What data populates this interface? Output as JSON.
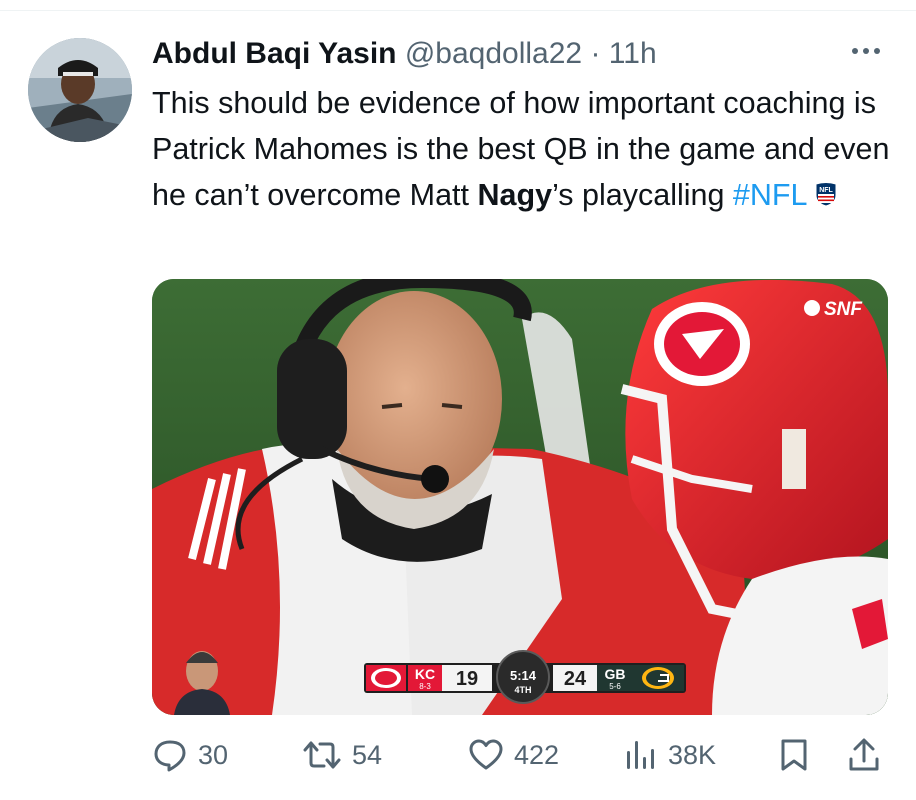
{
  "tweet": {
    "author_name": "Abdul Baqi Yasin",
    "handle": "@baqdolla22",
    "separator": "·",
    "time": "11h",
    "text_parts": {
      "p1": "This should be evidence of how important coaching is Patrick Mahomes is the best QB in the game and even he can’t overcome Matt ",
      "bold": "Nagy",
      "p2": "’s playcalling ",
      "hashtag": "#NFL"
    },
    "icons": {
      "more": "more-horizontal-icon",
      "nfl": "nfl-shield-emoji"
    }
  },
  "media": {
    "network_bug": "SNF",
    "scorebug": {
      "away_team": "KC",
      "away_record": "8-3",
      "away_score": "19",
      "clock": "5:14",
      "quarter": "4TH",
      "home_score": "24",
      "home_team": "GB",
      "home_record": "5-6"
    }
  },
  "actions": {
    "replies": "30",
    "retweets": "54",
    "likes": "422",
    "views": "38K"
  },
  "colors": {
    "link_blue": "#1d9bf0",
    "secondary_text": "#536471",
    "chiefs_red": "#e31837",
    "packers_green": "#203731"
  }
}
